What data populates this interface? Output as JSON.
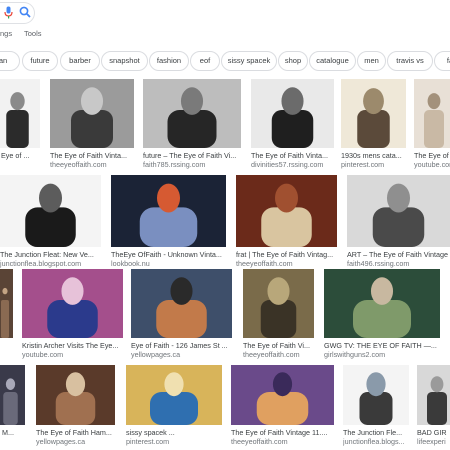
{
  "toolbar": {
    "tab_partial": "ngs",
    "tools": "Tools"
  },
  "chips": [
    "an",
    "future",
    "barber",
    "snapshot",
    "fashion",
    "eof",
    "sissy spacek",
    "shop",
    "catalogue",
    "men",
    "travis vs",
    "fa"
  ],
  "results": [
    {
      "title": "e Eye of ...",
      "source": ""
    },
    {
      "title": "The Eye of Faith Vinta...",
      "source": "theeyeoffaith.com"
    },
    {
      "title": "future – The Eye of Faith Vi...",
      "source": "faith785.rssing.com"
    },
    {
      "title": "The Eye of Faith Vinta...",
      "source": "divinities57.rssing.com"
    },
    {
      "title": "1930s mens cata...",
      "source": "pinterest.com"
    },
    {
      "title": "The Eye of",
      "source": "youtube.com"
    },
    {
      "title": "The Junction Fleat: New Ve...",
      "source": "junctionflea.blogspot.com"
    },
    {
      "title": "TheEye OfFaith - Unknown Vinta...",
      "source": "lookbook.nu"
    },
    {
      "title": "frat | The Eye of Faith Vintag...",
      "source": "theeyeoffaith.com"
    },
    {
      "title": "ART – The Eye of Faith Vintage",
      "source": "faith496.rssing.com"
    },
    {
      "title": "",
      "source": ""
    },
    {
      "title": "Kristin Archer Visits The Eye...",
      "source": "youtube.com"
    },
    {
      "title": "Eye of Faith - 126 James St ...",
      "source": "yellowpages.ca"
    },
    {
      "title": "The Eye of Faith Vi...",
      "source": "theeyeoffaith.com"
    },
    {
      "title": "GWG TV: THE EYE OF FAITH —...",
      "source": "girlswithguns2.com"
    },
    {
      "title": "b M...",
      "source": ""
    },
    {
      "title": "The Eye of Faith Ham...",
      "source": "yellowpages.ca"
    },
    {
      "title": "sissy spacek ...",
      "source": "pinterest.com"
    },
    {
      "title": "The Eye of Faith Vintage 11....",
      "source": "theeyeoffaith.com"
    },
    {
      "title": "The Junction Fle...",
      "source": "junctionflea.blogs..."
    },
    {
      "title": "BAD GIR",
      "source": "lifeexperi"
    }
  ],
  "colors": {
    "chip_border": "#dadce0",
    "text_primary": "#3c4043",
    "text_secondary": "#70757a",
    "accent_blue": "#4285f4"
  }
}
